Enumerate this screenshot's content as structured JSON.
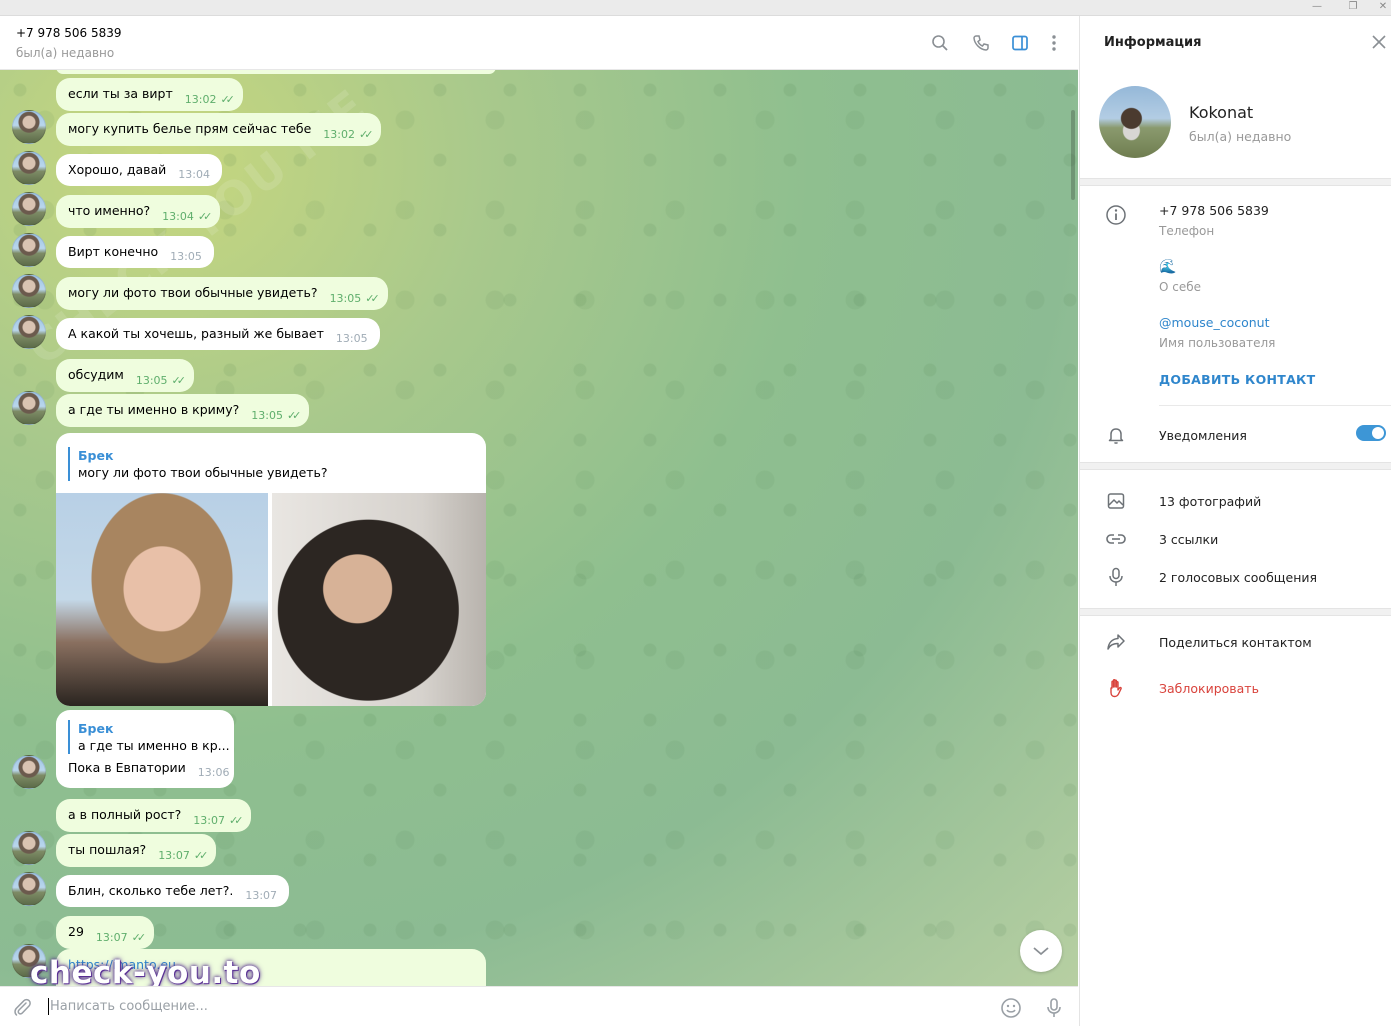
{
  "header": {
    "title": "+7 978 506 5839",
    "status": "был(а) недавно"
  },
  "messages": [
    {
      "text": "если ты за вирт",
      "time": "13:02",
      "out": true
    },
    {
      "text": "могу купить белье прям сейчас тебе",
      "time": "13:02",
      "out": true
    },
    {
      "text": "Хорошо, давай",
      "time": "13:04",
      "out": false
    },
    {
      "text": "что именно?",
      "time": "13:04",
      "out": true
    },
    {
      "text": "Вирт конечно",
      "time": "13:05",
      "out": false
    },
    {
      "text": "могу ли фото твои обычные увидеть?",
      "time": "13:05",
      "out": true
    },
    {
      "text": "А какой ты хочешь, разный же бывает",
      "time": "13:05",
      "out": false
    },
    {
      "text": "обсудим",
      "time": "13:05",
      "out": true
    },
    {
      "text": "а где ты именно в криму?",
      "time": "13:05",
      "out": true
    }
  ],
  "photo_message": {
    "reply_name": "Брек",
    "reply_text": "могу ли фото твои обычные увидеть?"
  },
  "reply_message": {
    "reply_name": "Брек",
    "reply_text": "а где ты именно в кр...",
    "text": "Пока в Евпатории",
    "time": "13:06"
  },
  "messages_after": [
    {
      "text": "а в полный рост?",
      "time": "13:07",
      "out": true
    },
    {
      "text": "ты пошлая?",
      "time": "13:07",
      "out": true
    },
    {
      "text": "Блин, сколько тебе лет?.",
      "time": "13:07",
      "out": false
    },
    {
      "text": "29",
      "time": "13:07",
      "out": true
    }
  ],
  "link_message": {
    "text": "https://imanto.eu"
  },
  "composer": {
    "placeholder": "Написать сообщение..."
  },
  "watermark": {
    "text": "check-you.to",
    "diagonal": "CHECK YOU ME"
  },
  "info": {
    "title": "Информация",
    "name": "Kokonat",
    "status": "был(а) недавно",
    "phone": "+7 978 506 5839",
    "phone_label": "Телефон",
    "about": "🌊",
    "about_label": "О себе",
    "username": "@mouse_coconut",
    "username_label": "Имя пользователя",
    "add_contact": "ДОБАВИТЬ КОНТАКТ",
    "notifications": "Уведомления",
    "notifications_on": true,
    "photos": "13 фотографий",
    "links": "3 ссылки",
    "voice": "2 голосовых сообщения",
    "share": "Поделиться контактом",
    "block": "Заблокировать"
  },
  "colors": {
    "accent": "#3a8fd6",
    "outgoing_bubble": "#effdde",
    "danger": "#d9433c"
  }
}
